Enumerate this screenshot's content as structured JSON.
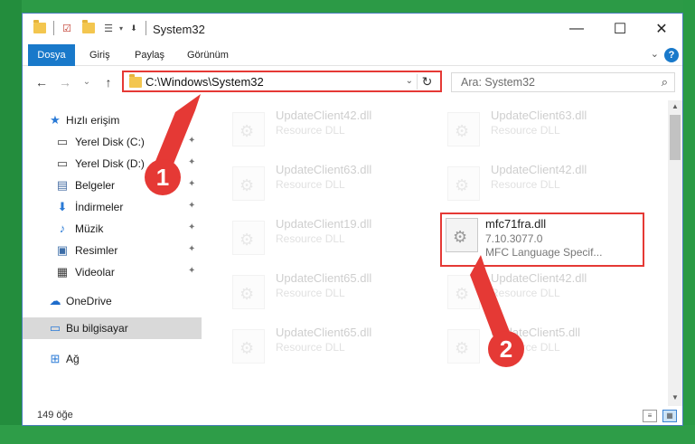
{
  "window": {
    "title": "System32",
    "controls": {
      "minimize": "—",
      "maximize": "☐",
      "close": "✕"
    }
  },
  "ribbon": {
    "tabs": [
      "Dosya",
      "Giriş",
      "Paylaş",
      "Görünüm"
    ],
    "help": "?",
    "collapse": "⌄"
  },
  "navigation": {
    "back": "←",
    "forward": "→",
    "recent": "⌄",
    "up": "↑",
    "address": "C:\\Windows\\System32",
    "address_chevron": "⌄",
    "refresh": "↻",
    "search_placeholder": "Ara: System32",
    "search_icon": "⌕"
  },
  "sidebar": {
    "items": [
      {
        "label": "Hızlı erişim",
        "icon": "star-icon",
        "glyph": "★",
        "color": "#2a7ad6"
      },
      {
        "label": "Yerel Disk (C:)",
        "icon": "drive-icon",
        "glyph": "▭",
        "color": "#444444",
        "pinned": true
      },
      {
        "label": "Yerel Disk (D:)",
        "icon": "drive-icon",
        "glyph": "▭",
        "color": "#444444",
        "pinned": true
      },
      {
        "label": "Belgeler",
        "icon": "documents-icon",
        "glyph": "▤",
        "color": "#4a6fa5",
        "pinned": true
      },
      {
        "label": "İndirmeler",
        "icon": "download-icon",
        "glyph": "⬇",
        "color": "#2a7ad6",
        "pinned": true
      },
      {
        "label": "Müzik",
        "icon": "music-icon",
        "glyph": "♪",
        "color": "#2a7ad6",
        "pinned": true
      },
      {
        "label": "Resimler",
        "icon": "pictures-icon",
        "glyph": "▣",
        "color": "#3d6ea8",
        "pinned": true
      },
      {
        "label": "Videolar",
        "icon": "videos-icon",
        "glyph": "▦",
        "color": "#3a3a3a",
        "pinned": true
      },
      {
        "label": "OneDrive",
        "icon": "cloud-icon",
        "glyph": "☁",
        "color": "#1e6ccb"
      },
      {
        "label": "Bu bilgisayar",
        "icon": "computer-icon",
        "glyph": "▭",
        "color": "#2a7ad6",
        "selected": true
      },
      {
        "label": "Ağ",
        "icon": "network-icon",
        "glyph": "⊞",
        "color": "#2a7ad6"
      }
    ],
    "pin_glyph": "📌"
  },
  "files": {
    "faded": [
      {
        "name": "UpdateClient42.dll",
        "desc": "Resource DLL"
      },
      {
        "name": "UpdateClient63.dll",
        "desc": "Resource DLL"
      },
      {
        "name": "UpdateClient63.dll",
        "desc": "Resource DLL"
      },
      {
        "name": "UpdateClient42.dll",
        "desc": "Resource DLL"
      },
      {
        "name": "UpdateClient19.dll",
        "desc": "Resource DLL"
      },
      {
        "name": "UpdateClient65.dll",
        "desc": "Resource DLL"
      },
      {
        "name": "UpdateClient42.dll",
        "desc": "Resource DLL"
      },
      {
        "name": "UpdateClient65.dll",
        "desc": "Resource DLL"
      },
      {
        "name": "UpdateClient5.dll",
        "desc": "Resource DLL"
      }
    ],
    "highlighted": {
      "name": "mfc71fra.dll",
      "version": "7.10.3077.0",
      "desc": "MFC Language Specif..."
    }
  },
  "status": {
    "item_count": "149 öğe"
  },
  "callouts": {
    "one": "1",
    "two": "2"
  },
  "colors": {
    "accent": "#1979ca",
    "highlight": "#e53935"
  }
}
